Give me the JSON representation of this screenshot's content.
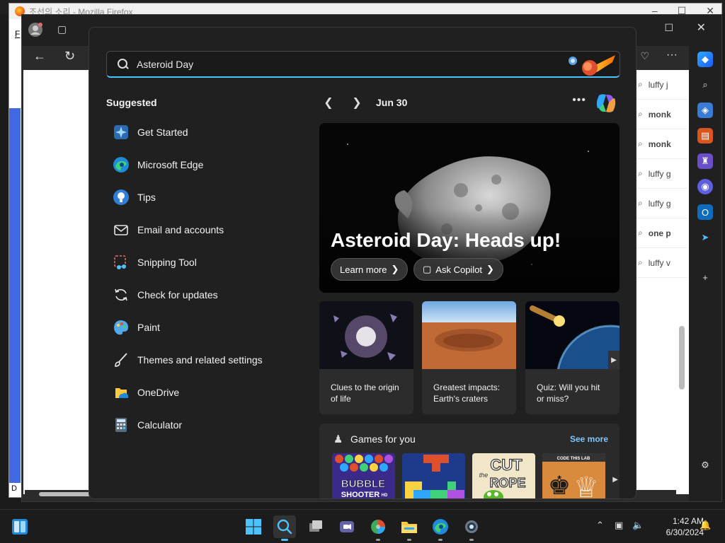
{
  "background": {
    "firefox_title": "조선의 소리 - Mozilla Firefox",
    "firefox_menu_letter": "F",
    "firefox_bottom_letter": "D",
    "edge_suggestions": [
      {
        "prefix": "luffy j",
        "bold": false
      },
      {
        "prefix": "monk",
        "bold": true
      },
      {
        "prefix": "monk",
        "bold": true
      },
      {
        "prefix": "luffy g",
        "bold": false
      },
      {
        "prefix": "luffy g",
        "bold": false
      },
      {
        "prefix": "one p",
        "bold": true
      },
      {
        "prefix": "luffy v",
        "bold": false
      }
    ]
  },
  "search": {
    "value": "Asteroid Day",
    "placeholder": ""
  },
  "suggested": {
    "title": "Suggested",
    "apps": [
      {
        "label": "Get Started",
        "icon": "get-started-icon"
      },
      {
        "label": "Microsoft Edge",
        "icon": "edge-icon"
      },
      {
        "label": "Tips",
        "icon": "tips-icon"
      },
      {
        "label": "Email and accounts",
        "icon": "email-icon"
      },
      {
        "label": "Snipping Tool",
        "icon": "snipping-tool-icon"
      },
      {
        "label": "Check for updates",
        "icon": "update-icon"
      },
      {
        "label": "Paint",
        "icon": "paint-icon"
      },
      {
        "label": "Themes and related settings",
        "icon": "brush-icon"
      },
      {
        "label": "OneDrive",
        "icon": "onedrive-icon"
      },
      {
        "label": "Calculator",
        "icon": "calculator-icon"
      }
    ]
  },
  "highlights": {
    "date": "Jun 30",
    "hero_title": "Asteroid Day: Heads up!",
    "learn_more": "Learn more",
    "ask_copilot": "Ask Copilot",
    "cards": [
      {
        "text": "Clues to the origin of life"
      },
      {
        "text": "Greatest impacts: Earth's craters"
      },
      {
        "text": "Quiz: Will you hit or miss?"
      }
    ]
  },
  "games": {
    "title": "Games for you",
    "see_more": "See more",
    "tiles": [
      {
        "line1": "BUBBLE",
        "line2": "SHOOTER",
        "line3": "HD"
      },
      {
        "line1": "",
        "line2": "",
        "line3": ""
      },
      {
        "line1": "CUT",
        "line2": "ROPE",
        "line3": "the"
      },
      {
        "line1": "CODE THIS LAB",
        "line2": "",
        "line3": ""
      }
    ]
  },
  "taskbar": {
    "time": "1:42 AM",
    "date": "6/30/2024"
  },
  "colors": {
    "accent": "#4cc2ff",
    "link": "#7fc8ff",
    "panel_bg": "#202020"
  }
}
